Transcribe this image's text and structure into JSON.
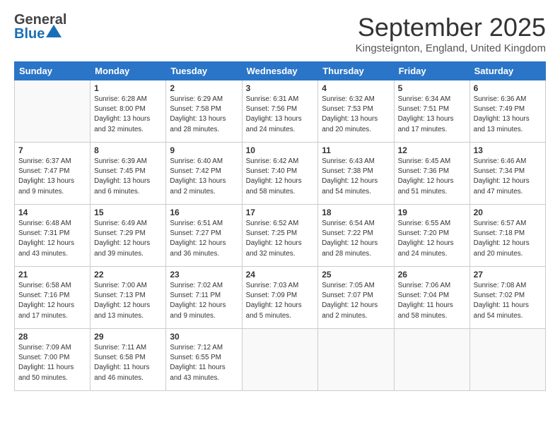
{
  "logo": {
    "general": "General",
    "blue": "Blue"
  },
  "title": "September 2025",
  "location": "Kingsteignton, England, United Kingdom",
  "days_of_week": [
    "Sunday",
    "Monday",
    "Tuesday",
    "Wednesday",
    "Thursday",
    "Friday",
    "Saturday"
  ],
  "weeks": [
    [
      {
        "day": "",
        "sunrise": "",
        "sunset": "",
        "daylight": ""
      },
      {
        "day": "1",
        "sunrise": "Sunrise: 6:28 AM",
        "sunset": "Sunset: 8:00 PM",
        "daylight": "Daylight: 13 hours and 32 minutes."
      },
      {
        "day": "2",
        "sunrise": "Sunrise: 6:29 AM",
        "sunset": "Sunset: 7:58 PM",
        "daylight": "Daylight: 13 hours and 28 minutes."
      },
      {
        "day": "3",
        "sunrise": "Sunrise: 6:31 AM",
        "sunset": "Sunset: 7:56 PM",
        "daylight": "Daylight: 13 hours and 24 minutes."
      },
      {
        "day": "4",
        "sunrise": "Sunrise: 6:32 AM",
        "sunset": "Sunset: 7:53 PM",
        "daylight": "Daylight: 13 hours and 20 minutes."
      },
      {
        "day": "5",
        "sunrise": "Sunrise: 6:34 AM",
        "sunset": "Sunset: 7:51 PM",
        "daylight": "Daylight: 13 hours and 17 minutes."
      },
      {
        "day": "6",
        "sunrise": "Sunrise: 6:36 AM",
        "sunset": "Sunset: 7:49 PM",
        "daylight": "Daylight: 13 hours and 13 minutes."
      }
    ],
    [
      {
        "day": "7",
        "sunrise": "Sunrise: 6:37 AM",
        "sunset": "Sunset: 7:47 PM",
        "daylight": "Daylight: 13 hours and 9 minutes."
      },
      {
        "day": "8",
        "sunrise": "Sunrise: 6:39 AM",
        "sunset": "Sunset: 7:45 PM",
        "daylight": "Daylight: 13 hours and 6 minutes."
      },
      {
        "day": "9",
        "sunrise": "Sunrise: 6:40 AM",
        "sunset": "Sunset: 7:42 PM",
        "daylight": "Daylight: 13 hours and 2 minutes."
      },
      {
        "day": "10",
        "sunrise": "Sunrise: 6:42 AM",
        "sunset": "Sunset: 7:40 PM",
        "daylight": "Daylight: 12 hours and 58 minutes."
      },
      {
        "day": "11",
        "sunrise": "Sunrise: 6:43 AM",
        "sunset": "Sunset: 7:38 PM",
        "daylight": "Daylight: 12 hours and 54 minutes."
      },
      {
        "day": "12",
        "sunrise": "Sunrise: 6:45 AM",
        "sunset": "Sunset: 7:36 PM",
        "daylight": "Daylight: 12 hours and 51 minutes."
      },
      {
        "day": "13",
        "sunrise": "Sunrise: 6:46 AM",
        "sunset": "Sunset: 7:34 PM",
        "daylight": "Daylight: 12 hours and 47 minutes."
      }
    ],
    [
      {
        "day": "14",
        "sunrise": "Sunrise: 6:48 AM",
        "sunset": "Sunset: 7:31 PM",
        "daylight": "Daylight: 12 hours and 43 minutes."
      },
      {
        "day": "15",
        "sunrise": "Sunrise: 6:49 AM",
        "sunset": "Sunset: 7:29 PM",
        "daylight": "Daylight: 12 hours and 39 minutes."
      },
      {
        "day": "16",
        "sunrise": "Sunrise: 6:51 AM",
        "sunset": "Sunset: 7:27 PM",
        "daylight": "Daylight: 12 hours and 36 minutes."
      },
      {
        "day": "17",
        "sunrise": "Sunrise: 6:52 AM",
        "sunset": "Sunset: 7:25 PM",
        "daylight": "Daylight: 12 hours and 32 minutes."
      },
      {
        "day": "18",
        "sunrise": "Sunrise: 6:54 AM",
        "sunset": "Sunset: 7:22 PM",
        "daylight": "Daylight: 12 hours and 28 minutes."
      },
      {
        "day": "19",
        "sunrise": "Sunrise: 6:55 AM",
        "sunset": "Sunset: 7:20 PM",
        "daylight": "Daylight: 12 hours and 24 minutes."
      },
      {
        "day": "20",
        "sunrise": "Sunrise: 6:57 AM",
        "sunset": "Sunset: 7:18 PM",
        "daylight": "Daylight: 12 hours and 20 minutes."
      }
    ],
    [
      {
        "day": "21",
        "sunrise": "Sunrise: 6:58 AM",
        "sunset": "Sunset: 7:16 PM",
        "daylight": "Daylight: 12 hours and 17 minutes."
      },
      {
        "day": "22",
        "sunrise": "Sunrise: 7:00 AM",
        "sunset": "Sunset: 7:13 PM",
        "daylight": "Daylight: 12 hours and 13 minutes."
      },
      {
        "day": "23",
        "sunrise": "Sunrise: 7:02 AM",
        "sunset": "Sunset: 7:11 PM",
        "daylight": "Daylight: 12 hours and 9 minutes."
      },
      {
        "day": "24",
        "sunrise": "Sunrise: 7:03 AM",
        "sunset": "Sunset: 7:09 PM",
        "daylight": "Daylight: 12 hours and 5 minutes."
      },
      {
        "day": "25",
        "sunrise": "Sunrise: 7:05 AM",
        "sunset": "Sunset: 7:07 PM",
        "daylight": "Daylight: 12 hours and 2 minutes."
      },
      {
        "day": "26",
        "sunrise": "Sunrise: 7:06 AM",
        "sunset": "Sunset: 7:04 PM",
        "daylight": "Daylight: 11 hours and 58 minutes."
      },
      {
        "day": "27",
        "sunrise": "Sunrise: 7:08 AM",
        "sunset": "Sunset: 7:02 PM",
        "daylight": "Daylight: 11 hours and 54 minutes."
      }
    ],
    [
      {
        "day": "28",
        "sunrise": "Sunrise: 7:09 AM",
        "sunset": "Sunset: 7:00 PM",
        "daylight": "Daylight: 11 hours and 50 minutes."
      },
      {
        "day": "29",
        "sunrise": "Sunrise: 7:11 AM",
        "sunset": "Sunset: 6:58 PM",
        "daylight": "Daylight: 11 hours and 46 minutes."
      },
      {
        "day": "30",
        "sunrise": "Sunrise: 7:12 AM",
        "sunset": "Sunset: 6:55 PM",
        "daylight": "Daylight: 11 hours and 43 minutes."
      },
      {
        "day": "",
        "sunrise": "",
        "sunset": "",
        "daylight": ""
      },
      {
        "day": "",
        "sunrise": "",
        "sunset": "",
        "daylight": ""
      },
      {
        "day": "",
        "sunrise": "",
        "sunset": "",
        "daylight": ""
      },
      {
        "day": "",
        "sunrise": "",
        "sunset": "",
        "daylight": ""
      }
    ]
  ]
}
